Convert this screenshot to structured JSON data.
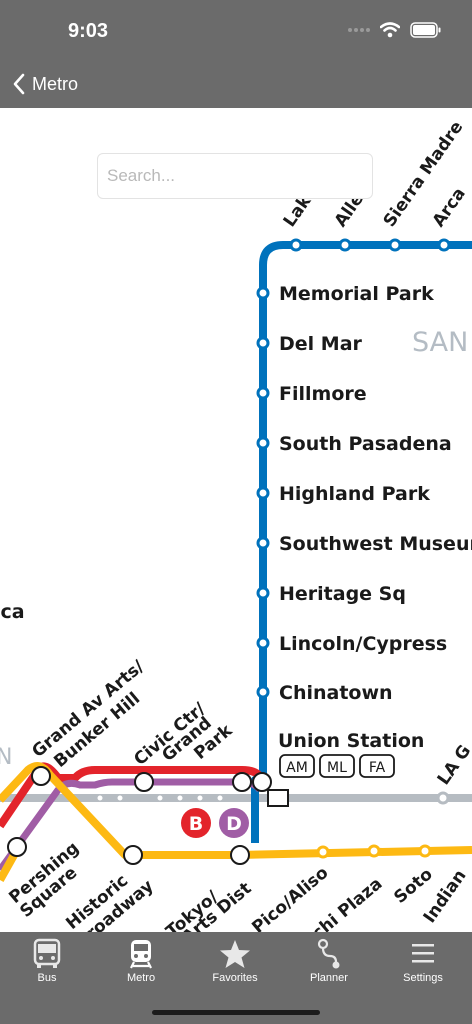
{
  "status_bar": {
    "time": "9:03"
  },
  "nav": {
    "back_label": "Metro"
  },
  "search": {
    "placeholder": "Search..."
  },
  "map": {
    "region_labels": [
      "SAN",
      "N"
    ],
    "stations_vertical": [
      "Memorial Park",
      "Del Mar",
      "Fillmore",
      "South Pasadena",
      "Highland Park",
      "Southwest Museum",
      "Heritage Sq",
      "Lincoln/Cypress",
      "Chinatown"
    ],
    "union_station": {
      "name": "Union Station",
      "badges": [
        "AM",
        "ML",
        "FA"
      ]
    },
    "stations_top": [
      "Lake",
      "Allen",
      "Sierra Madre",
      "Arca"
    ],
    "stations_left": [
      "ica",
      "Grand Av Arts/",
      "Bunker Hill",
      "Civic Ctr/",
      "Grand",
      "Park"
    ],
    "stations_bottom": [
      "Pershing",
      "Square",
      "Historic",
      "roadway",
      "Tokyo/",
      "Arts Dist",
      "Pico/Aliso",
      "chi Plaza",
      "Soto",
      "Indian",
      "LA G"
    ],
    "line_badges": [
      "B",
      "D"
    ],
    "colors": {
      "gold": "#0072bc",
      "red": "#e3242b",
      "purple": "#a05da5",
      "expo": "#fdb913",
      "rail": "#b6bcc2"
    }
  },
  "tabs": [
    {
      "label": "Bus",
      "icon": "bus-icon"
    },
    {
      "label": "Metro",
      "icon": "metro-icon",
      "active": true
    },
    {
      "label": "Favorites",
      "icon": "star-icon"
    },
    {
      "label": "Planner",
      "icon": "planner-icon"
    },
    {
      "label": "Settings",
      "icon": "settings-icon"
    }
  ]
}
